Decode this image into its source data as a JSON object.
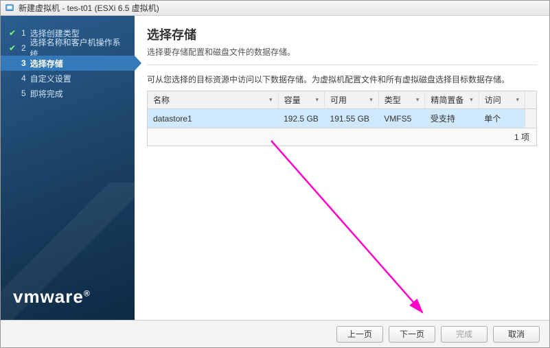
{
  "titlebar": {
    "icon_name": "vm-icon",
    "title": "新建虚拟机 - tes-t01 (ESXi 6.5 虚拟机)"
  },
  "sidebar": {
    "steps": [
      {
        "num": "1",
        "label": "选择创建类型",
        "done": true,
        "current": false
      },
      {
        "num": "2",
        "label": "选择名称和客户机操作系统",
        "done": true,
        "current": false
      },
      {
        "num": "3",
        "label": "选择存储",
        "done": false,
        "current": true
      },
      {
        "num": "4",
        "label": "自定义设置",
        "done": false,
        "current": false
      },
      {
        "num": "5",
        "label": "即将完成",
        "done": false,
        "current": false
      }
    ],
    "logo": "vmware",
    "logo_reg": "®"
  },
  "main": {
    "heading": "选择存储",
    "subtitle": "选择要存储配置和磁盘文件的数据存储。",
    "instruction": "可从您选择的目标资源中访问以下数据存储。为虚拟机配置文件和所有虚拟磁盘选择目标数据存储。",
    "columns": {
      "name": "名称",
      "capacity": "容量",
      "free": "可用",
      "type": "类型",
      "thin": "精简置备",
      "access": "访问"
    },
    "rows": [
      {
        "name": "datastore1",
        "capacity": "192.5 GB",
        "free": "191.55 GB",
        "type": "VMFS5",
        "thin": "受支持",
        "access": "单个",
        "selected": true
      }
    ],
    "count_label": "1 项"
  },
  "footer": {
    "back": "上一页",
    "next": "下一页",
    "finish": "完成",
    "cancel": "取消"
  }
}
